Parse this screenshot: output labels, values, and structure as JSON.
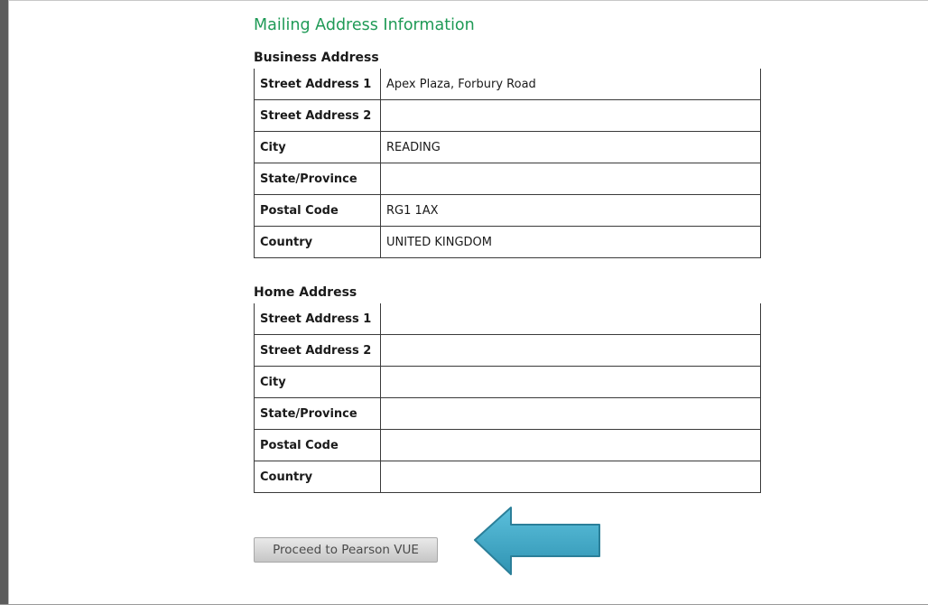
{
  "page_title": "Mailing Address Information",
  "business": {
    "title": "Business Address",
    "rows": [
      {
        "label": "Street Address 1",
        "value": "Apex Plaza, Forbury Road"
      },
      {
        "label": "Street Address 2",
        "value": ""
      },
      {
        "label": "City",
        "value": "READING"
      },
      {
        "label": "State/Province",
        "value": ""
      },
      {
        "label": "Postal Code",
        "value": "RG1 1AX"
      },
      {
        "label": "Country",
        "value": "UNITED KINGDOM"
      }
    ]
  },
  "home": {
    "title": "Home Address",
    "rows": [
      {
        "label": "Street Address 1",
        "value": ""
      },
      {
        "label": "Street Address 2",
        "value": ""
      },
      {
        "label": "City",
        "value": ""
      },
      {
        "label": "State/Province",
        "value": ""
      },
      {
        "label": "Postal Code",
        "value": ""
      },
      {
        "label": "Country",
        "value": ""
      }
    ]
  },
  "proceed_button": {
    "label": "Proceed to Pearson VUE"
  },
  "colors": {
    "title_green": "#1f9a56",
    "arrow_fill": "#3fa5c4",
    "arrow_stroke": "#2b7f99"
  },
  "annotation": {
    "icon": "arrow-left-icon"
  }
}
